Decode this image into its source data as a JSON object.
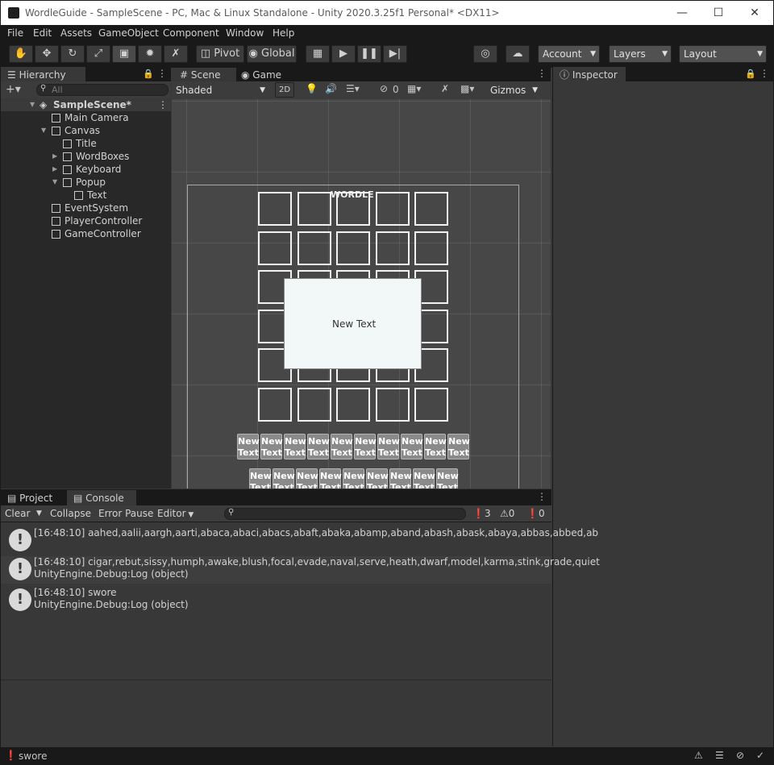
{
  "window": {
    "title": "WordleGuide - SampleScene - PC, Mac & Linux Standalone - Unity 2020.3.25f1 Personal* <DX11>"
  },
  "menu": [
    "File",
    "Edit",
    "Assets",
    "GameObject",
    "Component",
    "Window",
    "Help"
  ],
  "toolbar": {
    "pivot": "Pivot",
    "global": "Global",
    "account": "Account",
    "layers": "Layers",
    "layout": "Layout"
  },
  "hierarchy": {
    "tab": "Hierarchy",
    "search_placeholder": "All",
    "items": [
      {
        "label": "SampleScene*"
      },
      {
        "label": "Main Camera"
      },
      {
        "label": "Canvas"
      },
      {
        "label": "Title"
      },
      {
        "label": "WordBoxes"
      },
      {
        "label": "Keyboard"
      },
      {
        "label": "Popup"
      },
      {
        "label": "Text"
      },
      {
        "label": "EventSystem"
      },
      {
        "label": "PlayerController"
      },
      {
        "label": "GameController"
      }
    ]
  },
  "scene": {
    "tab_scene": "Scene",
    "tab_game": "Game",
    "shading": "Shaded",
    "mode_2d": "2D",
    "hidden_count": "0",
    "gizmos": "Gizmos",
    "canvas_title": "WORDLE",
    "popup_text": "New Text",
    "key_text": "New Text"
  },
  "inspector": {
    "tab": "Inspector"
  },
  "console": {
    "tab_project": "Project",
    "tab_console": "Console",
    "clear": "Clear",
    "collapse": "Collapse",
    "error_pause": "Error Pause",
    "editor": "Editor",
    "count_log": "3",
    "count_warn": "0",
    "count_err": "0",
    "entries": [
      {
        "line1": "[16:48:10] aahed,aalii,aargh,aarti,abaca,abaci,abacs,abaft,abaka,abamp,aband,abash,abask,abaya,abbas,abbed,ab",
        "line2": ""
      },
      {
        "line1": "[16:48:10] cigar,rebut,sissy,humph,awake,blush,focal,evade,naval,serve,heath,dwarf,model,karma,stink,grade,quiet",
        "line2": "UnityEngine.Debug:Log (object)"
      },
      {
        "line1": "[16:48:10] swore",
        "line2": "UnityEngine.Debug:Log (object)"
      }
    ]
  },
  "status": {
    "message": "swore"
  }
}
